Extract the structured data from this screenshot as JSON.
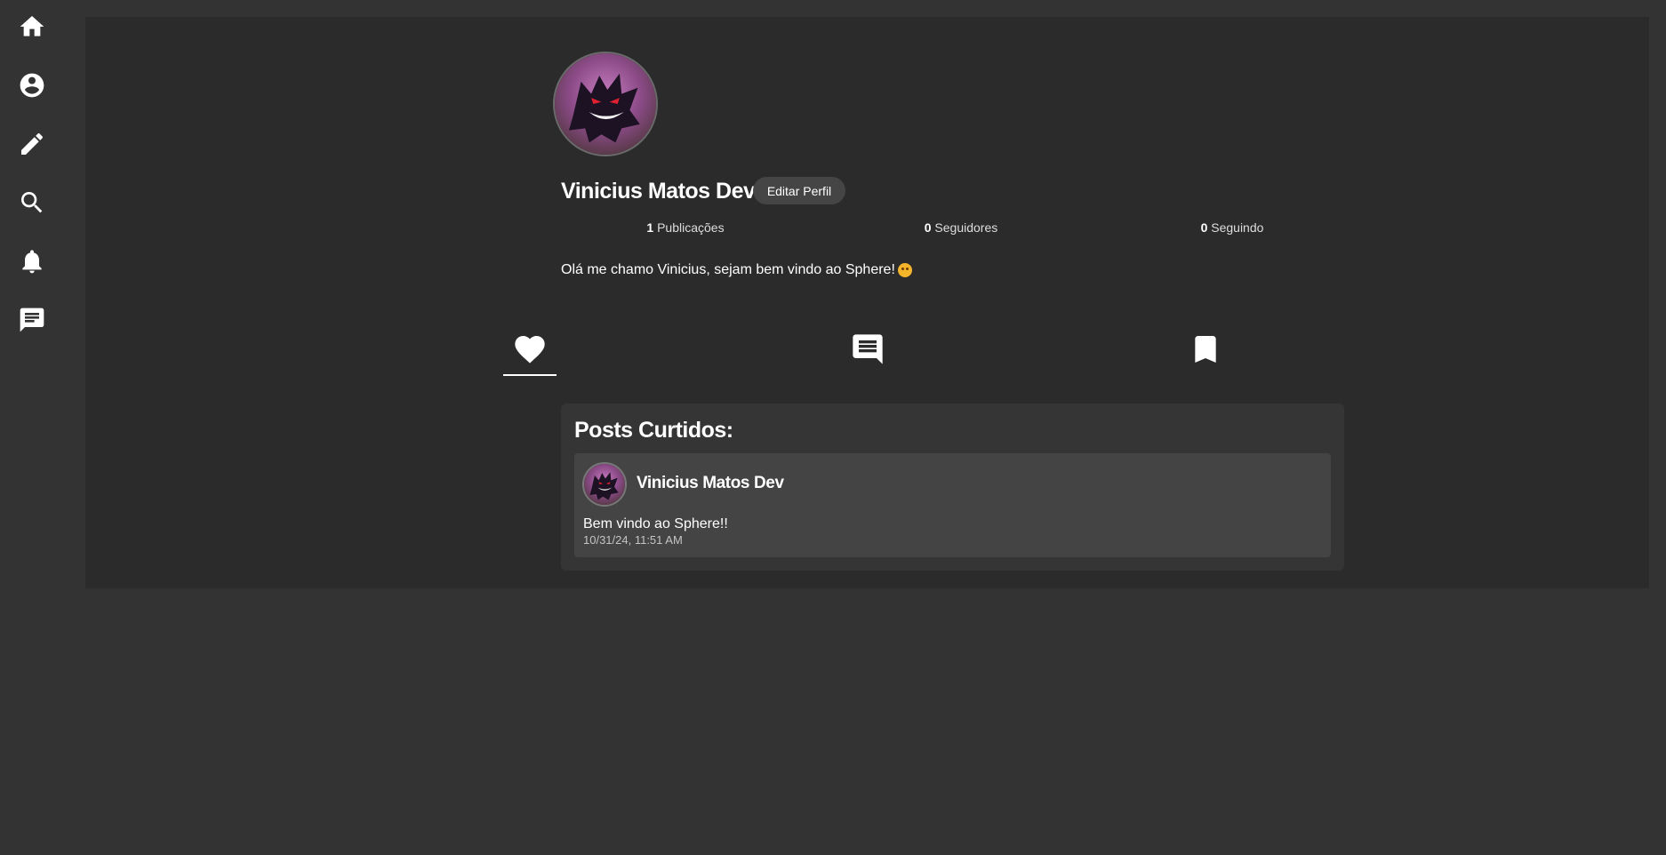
{
  "sidebar": {
    "items": [
      {
        "icon": "home-icon"
      },
      {
        "icon": "account-circle-icon"
      },
      {
        "icon": "pencil-icon"
      },
      {
        "icon": "search-icon"
      },
      {
        "icon": "bell-icon"
      },
      {
        "icon": "chat-icon"
      }
    ]
  },
  "profile": {
    "name": "Vinicius Matos Dev",
    "edit_label": "Editar Perfil",
    "stats": {
      "posts": {
        "count": "1",
        "label": "Publicações"
      },
      "followers": {
        "count": "0",
        "label": "Seguidores"
      },
      "following": {
        "count": "0",
        "label": "Seguindo"
      }
    },
    "bio": "Olá me chamo Vinicius, sejam bem vindo ao Sphere!"
  },
  "tabs": [
    {
      "icon": "heart-icon",
      "active": true
    },
    {
      "icon": "comment-icon",
      "active": false
    },
    {
      "icon": "bookmark-icon",
      "active": false
    }
  ],
  "liked": {
    "title": "Posts Curtidos:",
    "posts": [
      {
        "author": "Vinicius Matos Dev",
        "text": "Bem vindo ao Sphere!!",
        "timestamp": "10/31/24, 11:51 AM"
      }
    ]
  },
  "colors": {
    "background": "#333333",
    "panel": "#2b2b2b",
    "card": "#444444",
    "accent": "#ffffff"
  }
}
